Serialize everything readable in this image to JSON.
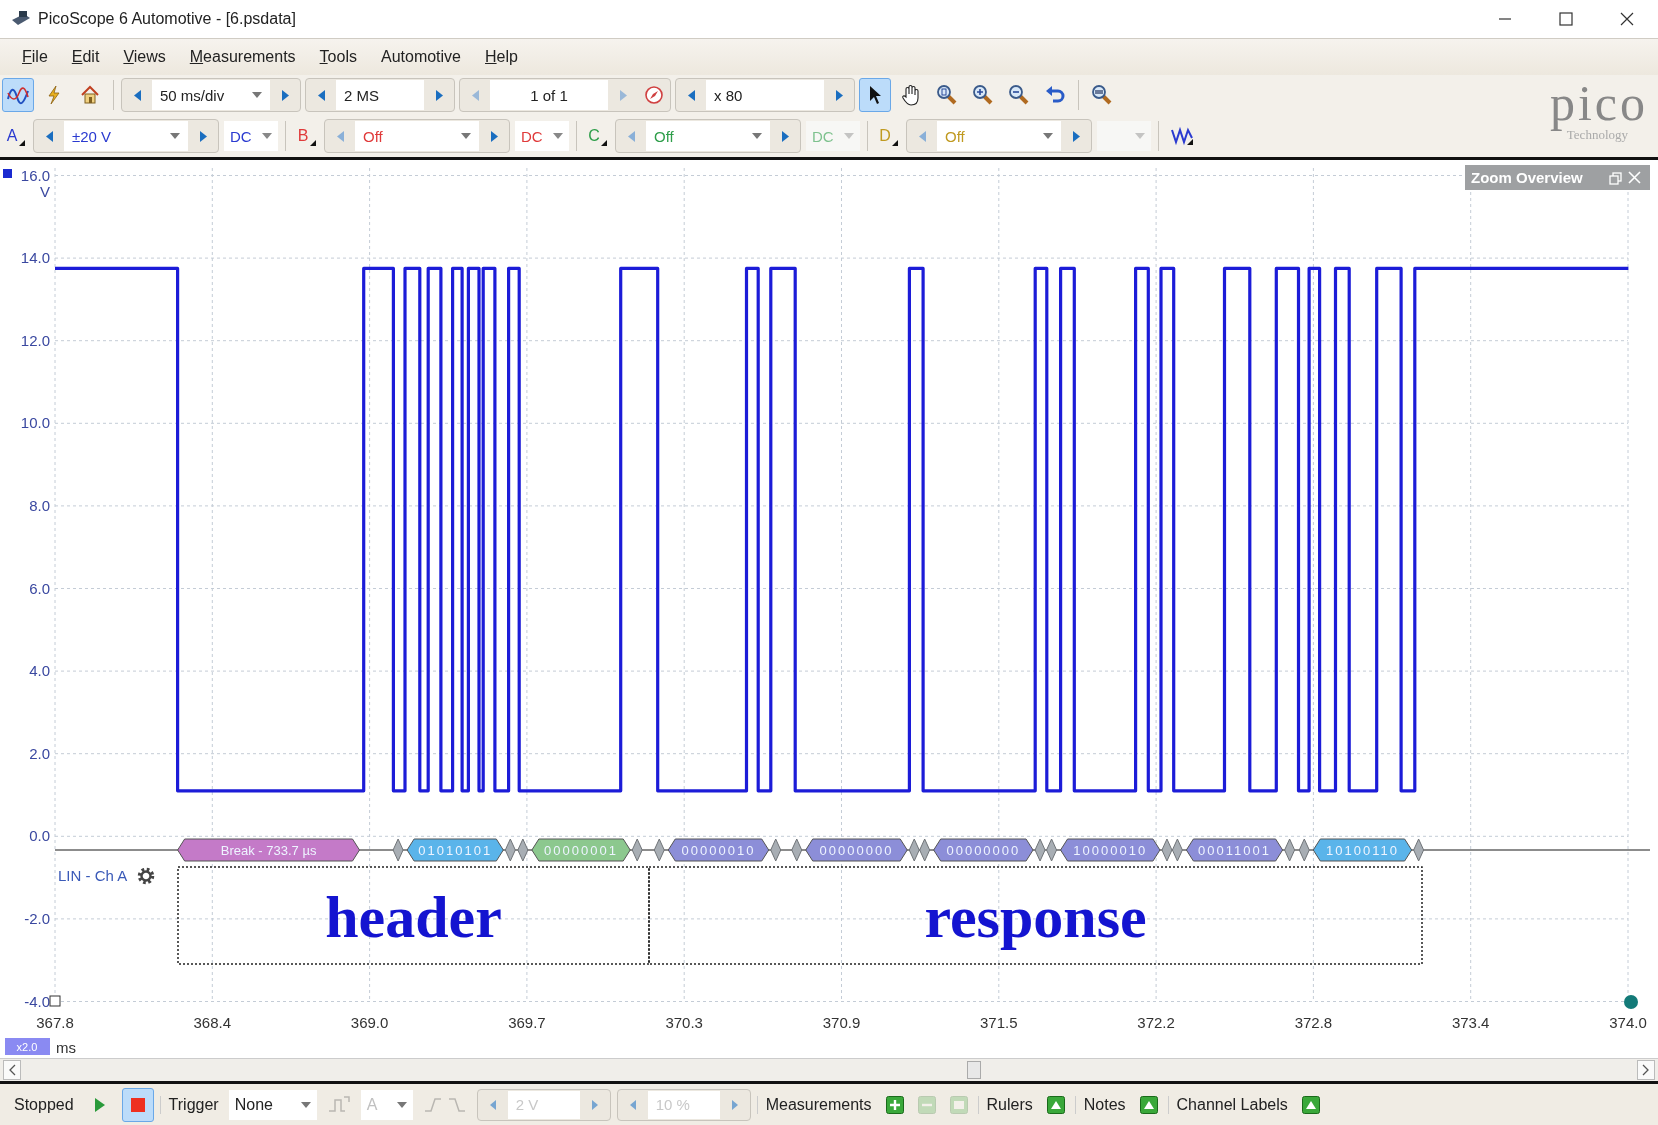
{
  "window": {
    "title": "PicoScope 6 Automotive - [6.psdata]"
  },
  "menu": [
    {
      "label": "File",
      "underlined_first": true
    },
    {
      "label": "Edit",
      "underlined_first": true
    },
    {
      "label": "Views",
      "underlined_first": true
    },
    {
      "label": "Measurements",
      "underlined_first": true
    },
    {
      "label": "Tools",
      "underlined_first": true
    },
    {
      "label": "Automotive",
      "underlined_first": false
    },
    {
      "label": "Help",
      "underlined_first": true
    }
  ],
  "toolbar": [
    {
      "kind": "scope-mode",
      "selected": true
    },
    {
      "kind": "probe",
      "selected": false
    },
    {
      "kind": "home",
      "selected": false
    },
    {
      "kind": "separator"
    },
    {
      "kind": "spinner-dropdown",
      "text": "50 ms/div"
    },
    {
      "kind": "spinner",
      "text": "2 MS"
    },
    {
      "kind": "buffer",
      "text": "1 of 1"
    },
    {
      "kind": "spinner",
      "text": "x 80"
    },
    {
      "kind": "pointer",
      "selected": true
    },
    {
      "kind": "hand",
      "selected": false
    },
    {
      "kind": "zoom-fit",
      "selected": false
    },
    {
      "kind": "zoom-in",
      "selected": false
    },
    {
      "kind": "zoom-out",
      "selected": false
    },
    {
      "kind": "undo",
      "selected": false
    },
    {
      "kind": "separator"
    },
    {
      "kind": "zoom-overview",
      "selected": false
    }
  ],
  "logo": {
    "name": "pico",
    "tagline": "Technology"
  },
  "channels": [
    {
      "letter": "A",
      "color": "#2a3ad0",
      "range": "±20 V",
      "coupling": "DC",
      "coupling_enabled": true
    },
    {
      "letter": "B",
      "color": "#e03a3a",
      "range": "Off",
      "coupling": "DC",
      "coupling_enabled": true
    },
    {
      "letter": "C",
      "color": "#2e9e4a",
      "range": "Off",
      "coupling": "DC",
      "coupling_enabled": false
    },
    {
      "letter": "D",
      "color": "#c09a20",
      "range": "Off",
      "coupling_enabled": false
    }
  ],
  "plot": {
    "y_unit": "V",
    "y_ticks": [
      "16.0",
      "14.0",
      "12.0",
      "10.0",
      "8.0",
      "6.0",
      "4.0",
      "2.0",
      "0.0",
      "-2.0",
      "-4.0"
    ],
    "x_ticks": [
      "367.8",
      "368.4",
      "369.0",
      "369.7",
      "370.3",
      "370.9",
      "371.5",
      "372.2",
      "372.8",
      "373.4",
      "374.0"
    ],
    "x_unit": "ms",
    "zoom_badge": "x2.0",
    "zoom_overview": {
      "title": "Zoom Overview"
    },
    "decoder": {
      "label": "LIN - Ch A",
      "packets": [
        {
          "text": "Break - 733.7 µs",
          "color": "#c47ac8"
        },
        {
          "text": "01010101",
          "color": "#5ab4ea"
        },
        {
          "text": "00000001",
          "color": "#8cc88e"
        },
        {
          "text": "00000010",
          "color": "#8c8ed8"
        },
        {
          "text": "00000000",
          "color": "#8c8ed8"
        },
        {
          "text": "00000000",
          "color": "#8c8ed8"
        },
        {
          "text": "10000010",
          "color": "#8c8ed8"
        },
        {
          "text": "00011001",
          "color": "#8c8ed8"
        },
        {
          "text": "10100110",
          "color": "#5ab4ea"
        }
      ]
    },
    "notes": [
      {
        "text": "header"
      },
      {
        "text": "response"
      }
    ]
  },
  "status_bar": [
    {
      "kind": "label",
      "text": "Stopped"
    },
    {
      "kind": "run",
      "selected": false
    },
    {
      "kind": "stop",
      "selected": true
    },
    {
      "kind": "label",
      "text": "Trigger"
    },
    {
      "kind": "dropdown",
      "text": "None",
      "disabled": false
    },
    {
      "kind": "trigger-type",
      "disabled": true
    },
    {
      "kind": "dropdown",
      "text": "A",
      "disabled": true
    },
    {
      "kind": "edge",
      "disabled": true
    },
    {
      "kind": "spinner",
      "text": "2 V",
      "disabled": true
    },
    {
      "kind": "spinner",
      "text": "10 %",
      "disabled": true
    },
    {
      "kind": "label",
      "text": "Measurements"
    },
    {
      "kind": "add",
      "disabled": false
    },
    {
      "kind": "remove",
      "disabled": true
    },
    {
      "kind": "edit",
      "disabled": true
    },
    {
      "kind": "label",
      "text": "Rulers"
    },
    {
      "kind": "panel-toggle"
    },
    {
      "kind": "label",
      "text": "Notes"
    },
    {
      "kind": "panel-toggle"
    },
    {
      "kind": "label",
      "text": "Channel Labels"
    },
    {
      "kind": "panel-toggle"
    }
  ]
}
